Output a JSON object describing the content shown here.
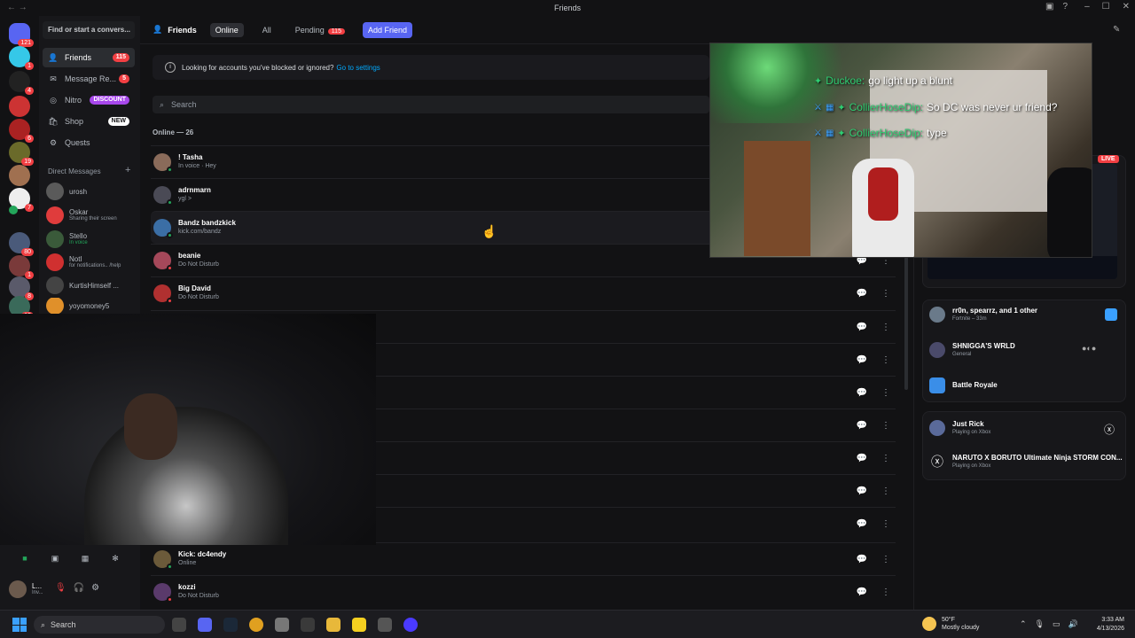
{
  "window": {
    "title": "Friends"
  },
  "servers": {
    "home_badge": "121",
    "badges": [
      "1",
      "4",
      "6",
      "19",
      "7",
      "80",
      "1",
      "8",
      "12"
    ]
  },
  "sidebar": {
    "search_placeholder": "Find or start a convers...",
    "nav": [
      {
        "label": "Friends",
        "badge": "115",
        "icon": "friends-icon"
      },
      {
        "label": "Message Re...",
        "badge": "5",
        "icon": "inbox-icon"
      },
      {
        "label": "Nitro",
        "badge": "DISCOUNT",
        "icon": "nitro-icon"
      },
      {
        "label": "Shop",
        "badge": "NEW",
        "icon": "shop-icon"
      },
      {
        "label": "Quests",
        "badge": "",
        "icon": "quests-icon"
      }
    ],
    "dm_header": "Direct Messages",
    "dms": [
      {
        "name": "urosh",
        "status": ""
      },
      {
        "name": "Oskar",
        "status": "Sharing their screen"
      },
      {
        "name": "Stello",
        "status": "In voice"
      },
      {
        "name": "Notl",
        "status": "for notifications.. /help"
      },
      {
        "name": "KurtisHimself ...",
        "status": ""
      },
      {
        "name": "yoyomoney5",
        "status": ""
      }
    ]
  },
  "toolbar": {
    "title": "Friends",
    "tabs": [
      "Online",
      "All",
      "Pending"
    ],
    "pending_badge": "115",
    "add_friend": "Add Friend"
  },
  "notice": {
    "text": "Looking for accounts you've blocked or ignored?",
    "link": "Go to settings"
  },
  "search": {
    "placeholder": "Search"
  },
  "friends_list": {
    "header": "Online — 26",
    "top": [
      {
        "name": "! Tasha",
        "status": "In voice · Hey",
        "color": "#8a6b5a",
        "dot": "#23a55a"
      },
      {
        "name": "adrnmarn",
        "status": "ygl >",
        "color": "#4a4a55",
        "dot": "#23a55a"
      },
      {
        "name": "Bandz bandzkick",
        "status": "kick.com/bandz",
        "color": "#3b6ea5",
        "dot": "#23a55a"
      },
      {
        "name": "beanie",
        "status": "Do Not Disturb",
        "color": "#a5485a",
        "dot": "#f23f43"
      },
      {
        "name": "Big David",
        "status": "Do Not Disturb",
        "color": "#b03030",
        "dot": "#f23f43"
      }
    ],
    "bottom": [
      {
        "name": "Kick: dc4endy",
        "status": "Online",
        "color": "#6b5a3a",
        "dot": "#23a55a"
      },
      {
        "name": "kozzi",
        "status": "Do Not Disturb",
        "color": "#5a3a6b",
        "dot": "#f23f43"
      }
    ]
  },
  "stream_chat": [
    {
      "user": "Duckoe:",
      "message": "go light up a blunt"
    },
    {
      "user": "CollierHoseDip:",
      "message": "So DC was never ur friend?"
    },
    {
      "user": "CollierHoseDip:",
      "message": "type"
    }
  ],
  "active_now": {
    "live_label": "LIVE",
    "activities": [
      {
        "name": "rr0n, spearrz, and 1 other",
        "sub": "Fortnite – 33m"
      },
      {
        "name": "SHNIGGA'S WRLD",
        "sub": "General"
      },
      {
        "name": "Battle Royale",
        "sub": ""
      },
      {
        "name": "Just Rick",
        "sub": "Playing on Xbox"
      },
      {
        "name": "NARUTO X BORUTO Ultimate Ninja STORM CON...",
        "sub": "Playing on Xbox"
      }
    ]
  },
  "user_panel": {
    "name": "L...",
    "status": "Inv..."
  },
  "taskbar": {
    "search": "Search",
    "weather_temp": "50°F",
    "weather_desc": "Mostly cloudy",
    "time": "3:33 AM",
    "date": "4/13/2026"
  }
}
